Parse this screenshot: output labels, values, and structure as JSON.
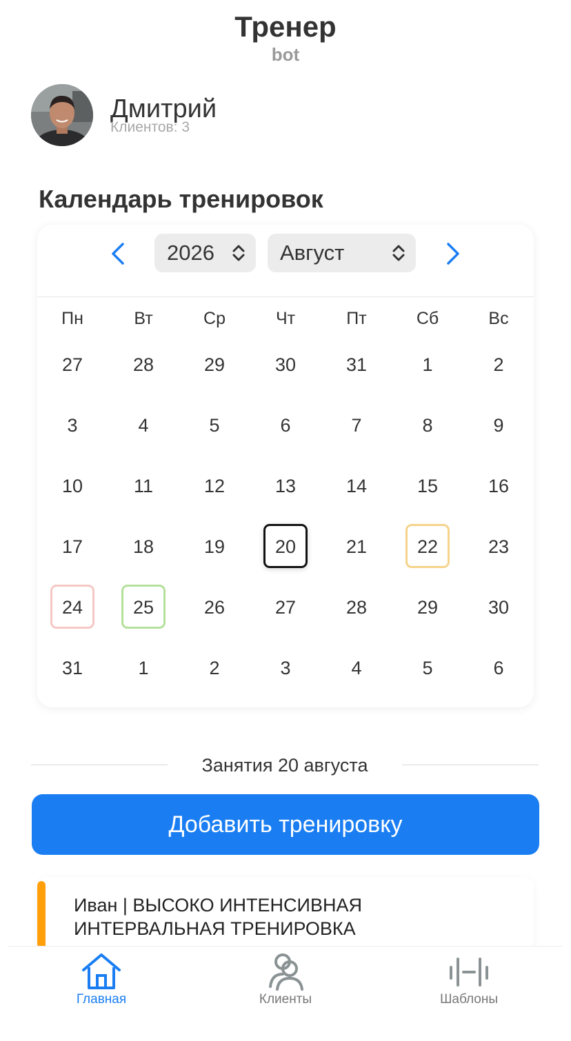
{
  "header": {
    "title": "Тренер",
    "subtitle": "bot"
  },
  "profile": {
    "name": "Дмитрий",
    "clients_text": "Клиентов: 3"
  },
  "calendar": {
    "section_title": "Календарь тренировок",
    "year": "2026",
    "month": "Август",
    "weekdays": [
      "Пн",
      "Вт",
      "Ср",
      "Чт",
      "Пт",
      "Сб",
      "Вс"
    ],
    "weeks": [
      [
        "27",
        "28",
        "29",
        "30",
        "31",
        "1",
        "2"
      ],
      [
        "3",
        "4",
        "5",
        "6",
        "7",
        "8",
        "9"
      ],
      [
        "10",
        "11",
        "12",
        "13",
        "14",
        "15",
        "16"
      ],
      [
        "17",
        "18",
        "19",
        "20",
        "21",
        "22",
        "23"
      ],
      [
        "24",
        "25",
        "26",
        "27",
        "28",
        "29",
        "30"
      ],
      [
        "31",
        "1",
        "2",
        "3",
        "4",
        "5",
        "6"
      ]
    ],
    "selected_day": "20",
    "marked_days": [
      {
        "day": "22",
        "color": "#f5d38a"
      },
      {
        "day": "24",
        "color": "#f5c8c4"
      },
      {
        "day": "25",
        "color": "#b4e09a"
      }
    ]
  },
  "sessions": {
    "heading": "Занятия 20 августа",
    "add_button": "Добавить тренировку",
    "items": [
      {
        "text": "Иван | ВЫСОКО ИНТЕНСИВНАЯ ИНТЕРВАЛЬНАЯ ТРЕНИРОВКА",
        "color": "#ff9f0a"
      }
    ]
  },
  "tabbar": {
    "items": [
      {
        "label": "Главная",
        "icon": "home-icon",
        "active": true
      },
      {
        "label": "Клиенты",
        "icon": "users-icon",
        "active": false
      },
      {
        "label": "Шаблоны",
        "icon": "dumbbell-icon",
        "active": false
      }
    ]
  },
  "colors": {
    "accent": "#1a7ef2",
    "text": "#333333",
    "muted": "#a8a8a8"
  }
}
